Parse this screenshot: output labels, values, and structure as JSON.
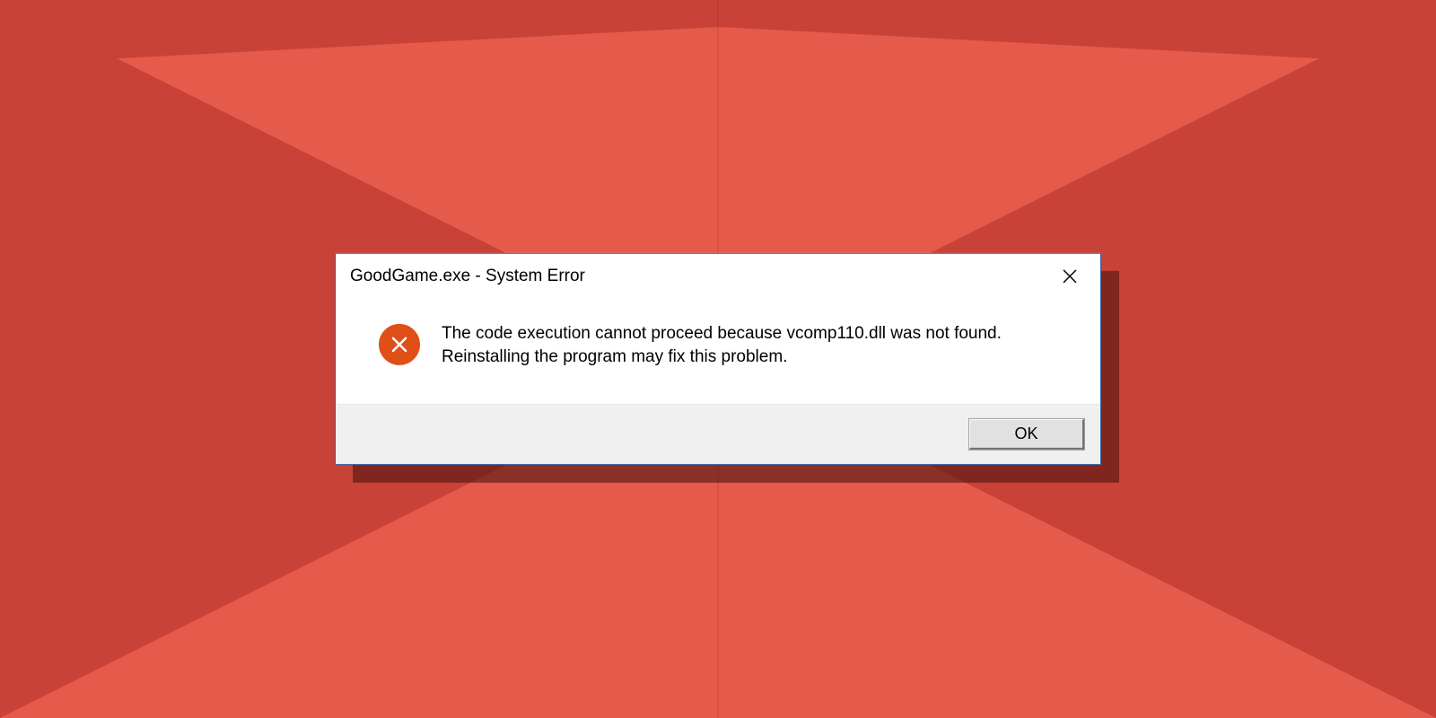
{
  "background": {
    "color_light": "#e55a4a",
    "color_dark": "#c94237"
  },
  "dialog": {
    "title": "GoodGame.exe - System Error",
    "message": "The code execution cannot proceed because vcomp110.dll was not found. Reinstalling the program may fix this problem.",
    "ok_label": "OK",
    "icon": "error-x-icon",
    "close_icon": "close-icon"
  }
}
